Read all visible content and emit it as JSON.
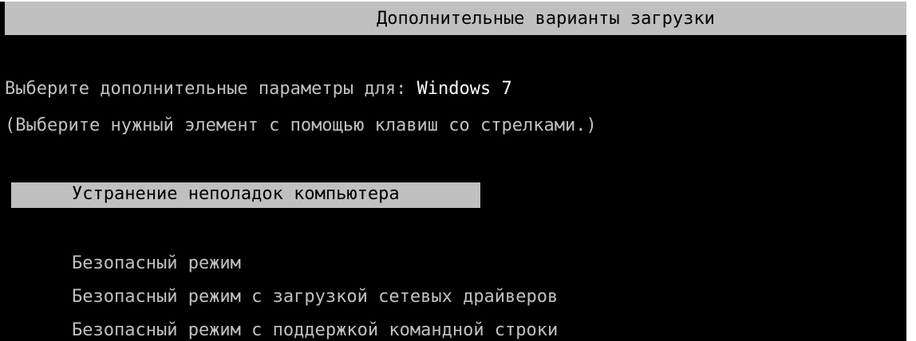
{
  "header": {
    "title": "Дополнительные варианты загрузки"
  },
  "prompt": {
    "label": "Выберите дополнительные параметры для: ",
    "os_name": "Windows 7"
  },
  "hint": "(Выберите нужный элемент с помощью клавиш со стрелками.)",
  "menu": {
    "selected_index": 0,
    "items": [
      {
        "label": "Устранение неполадок компьютера"
      },
      {
        "label": "Безопасный режим"
      },
      {
        "label": "Безопасный режим с загрузкой сетевых драйверов"
      },
      {
        "label": "Безопасный режим с поддержкой командной строки"
      }
    ]
  },
  "colors": {
    "background": "#000000",
    "text": "#c0c0c0",
    "highlight_bg": "#c0c0c0",
    "highlight_text": "#000000",
    "emphasis": "#ffffff"
  }
}
